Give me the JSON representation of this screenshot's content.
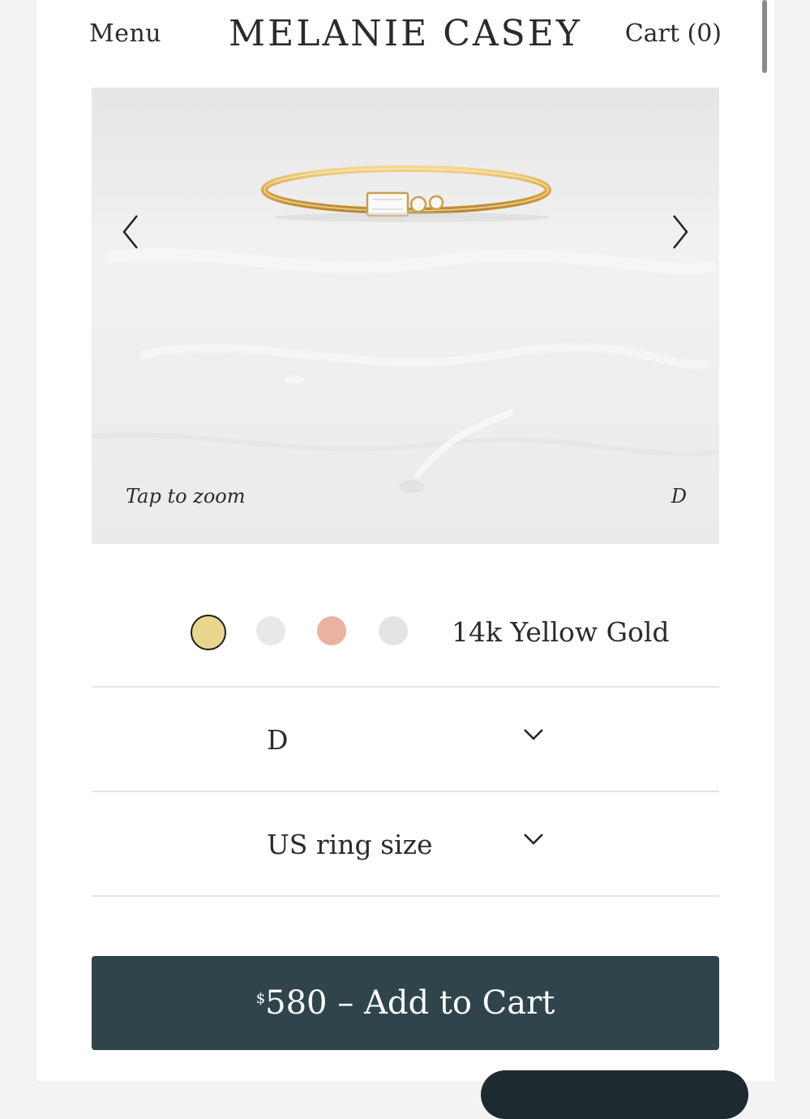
{
  "header": {
    "menu_label": "Menu",
    "brand": "MELANIE CASEY",
    "cart_label": "Cart (0)"
  },
  "gallery": {
    "zoom_hint": "Tap to zoom",
    "style_tag": "D",
    "prev_icon": "chevron-left-icon",
    "next_icon": "chevron-right-icon"
  },
  "metal": {
    "selected_label": "14k Yellow Gold",
    "swatches": [
      {
        "name": "yellow-gold",
        "color": "#e8d68f",
        "selected": true
      },
      {
        "name": "white-gold",
        "color": "#e8e8e8",
        "selected": false
      },
      {
        "name": "rose-gold",
        "color": "#ebb2a1",
        "selected": false
      },
      {
        "name": "platinum",
        "color": "#e4e4e4",
        "selected": false
      }
    ]
  },
  "options": {
    "style_select_value": "D",
    "size_select_placeholder": "US ring size"
  },
  "cart_button": {
    "currency": "$",
    "price": "580",
    "label": " – Add to Cart"
  },
  "colors": {
    "button_bg": "#2f454b",
    "page_bg": "#ffffff",
    "gold": "#d9a84a"
  }
}
